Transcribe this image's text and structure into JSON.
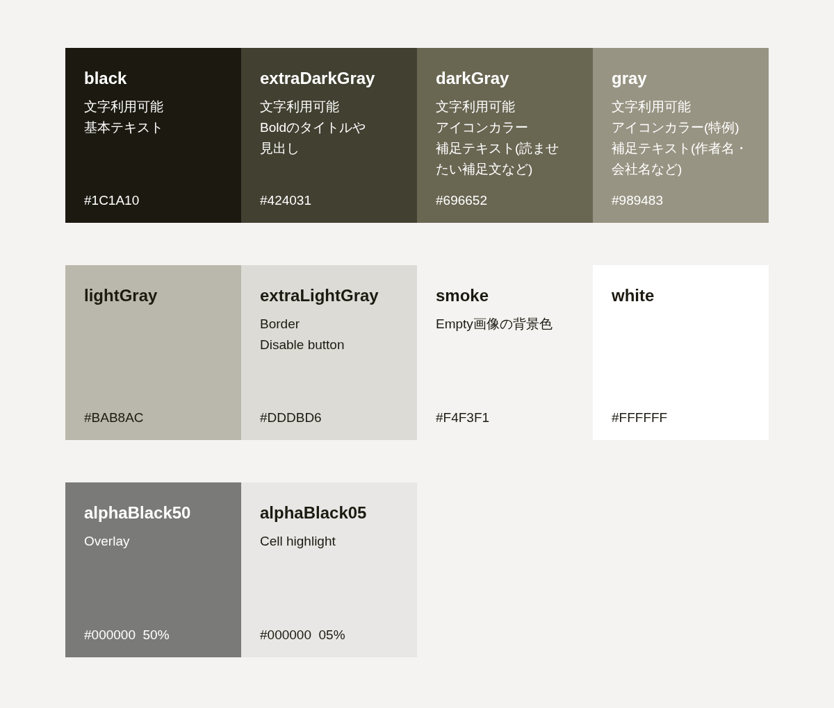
{
  "rows": [
    {
      "swatches": [
        {
          "name": "black",
          "kind": "dark",
          "color": "#1c1a10",
          "lines": [
            "文字利用可能",
            "基本テキスト"
          ],
          "hex": "#1C1A10"
        },
        {
          "name": "extraDarkGray",
          "kind": "dark",
          "color": "#424031",
          "lines": [
            "文字利用可能",
            "Boldのタイトルや",
            "見出し"
          ],
          "hex": "#424031"
        },
        {
          "name": "darkGray",
          "kind": "dark",
          "color": "#696652",
          "lines": [
            "文字利用可能",
            "アイコンカラー",
            "補足テキスト(読ませ",
            "たい補足文など)"
          ],
          "hex": "#696652"
        },
        {
          "name": "gray",
          "kind": "dark",
          "color": "#989483",
          "lines": [
            "文字利用可能",
            "アイコンカラー(特例)",
            "補足テキスト(作者名・",
            "会社名など)"
          ],
          "hex": "#989483"
        }
      ]
    },
    {
      "swatches": [
        {
          "name": "lightGray",
          "kind": "light",
          "color": "#bab8ac",
          "hex": "#BAB8AC"
        },
        {
          "name": "extraLightGray",
          "kind": "light",
          "color": "#dddbd6",
          "lines": [
            "Border",
            "Disable button"
          ],
          "hex": "#DDDBD6"
        },
        {
          "name": "smoke",
          "kind": "light",
          "color": "#f4f3f1",
          "lines": [
            "Empty画像の背景色"
          ],
          "hex": "#F4F3F1"
        },
        {
          "name": "white",
          "kind": "light",
          "color": "#ffffff",
          "hex": "#FFFFFF"
        }
      ]
    },
    {
      "swatches": [
        {
          "name": "alphaBlack50",
          "kind": "dark",
          "color": "#7a7a79",
          "lines": [
            "Overlay"
          ],
          "hex": "#000000  50%"
        },
        {
          "name": "alphaBlack05",
          "kind": "light",
          "color": "#e8e7e5",
          "lines": [
            "Cell highlight"
          ],
          "hex": "#000000  05%"
        }
      ]
    }
  ]
}
